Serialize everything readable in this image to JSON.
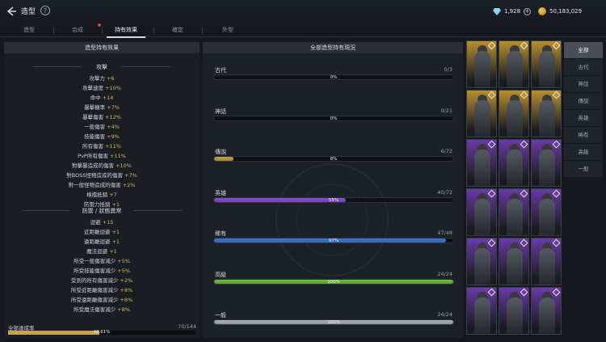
{
  "header": {
    "title": "造型",
    "gems": "1,928",
    "gold": "50,183,029"
  },
  "tabs": [
    {
      "label": "造型"
    },
    {
      "label": "合成"
    },
    {
      "label": "持有效果"
    },
    {
      "label": "確定"
    },
    {
      "label": "外型"
    }
  ],
  "left_panel": {
    "title": "造型持有效果",
    "attack_title": "攻擊",
    "attack_stats": [
      {
        "name": "攻擊力",
        "value": "+6"
      },
      {
        "name": "攻擊速度",
        "value": "+10%"
      },
      {
        "name": "命中",
        "value": "+14"
      },
      {
        "name": "暴擊機率",
        "value": "+7%"
      },
      {
        "name": "暴擊傷害",
        "value": "+12%"
      },
      {
        "name": "一般傷害",
        "value": "+4%"
      },
      {
        "name": "技能傷害",
        "value": "+9%"
      },
      {
        "name": "所有傷害",
        "value": "+11%"
      },
      {
        "name": "PvP所有傷害",
        "value": "+11%"
      },
      {
        "name": "對擊暴造成的傷害",
        "value": "+10%"
      },
      {
        "name": "對BOSS怪物造成的傷害",
        "value": "+7%"
      },
      {
        "name": "對一般怪物造成的傷害",
        "value": "+2%"
      },
      {
        "name": "格擋抵銷",
        "value": "+7"
      },
      {
        "name": "防禦力抵銷",
        "value": "+1"
      }
    ],
    "defense_title": "防禦 / 狀態異常",
    "defense_stats": [
      {
        "name": "迴避",
        "value": "+15"
      },
      {
        "name": "近距離迴避",
        "value": "+1"
      },
      {
        "name": "遠距離迴避",
        "value": "+1"
      },
      {
        "name": "魔法迴避",
        "value": "+1"
      },
      {
        "name": "所受一般傷害減少",
        "value": "+5%"
      },
      {
        "name": "所受技能傷害減少",
        "value": "+5%"
      },
      {
        "name": "受到的所有傷害減少",
        "value": "+2%"
      },
      {
        "name": "所受近距離傷害減少",
        "value": "+8%"
      },
      {
        "name": "所受遠距離傷害減少",
        "value": "+8%"
      },
      {
        "name": "所受魔法傷害減少",
        "value": "+8%"
      }
    ],
    "achievement_label": "全部達成率",
    "achievement_count": "70/144",
    "achievement_pct": "48.61%",
    "achievement_fraction": 0.4861
  },
  "mid_panel": {
    "title": "全部造型持有現況",
    "rarities": [
      {
        "name": "古代",
        "count": "0/3",
        "pct": "0%",
        "fraction": 0.0,
        "color": "#7d8a95"
      },
      {
        "name": "神話",
        "count": "0/21",
        "pct": "0%",
        "fraction": 0.0,
        "color": "#c0392b"
      },
      {
        "name": "傳說",
        "count": "6/72",
        "pct": "8%",
        "fraction": 0.08,
        "color": "#c8a03f"
      },
      {
        "name": "英雄",
        "count": "40/72",
        "pct": "55%",
        "fraction": 0.55,
        "color": "#8a4fd6"
      },
      {
        "name": "稀有",
        "count": "47/48",
        "pct": "97%",
        "fraction": 0.97,
        "color": "#3a78d6"
      },
      {
        "name": "高級",
        "count": "24/24",
        "pct": "100%",
        "fraction": 1.0,
        "color": "#6fbf3a"
      },
      {
        "name": "一般",
        "count": "24/24",
        "pct": "100%",
        "fraction": 1.0,
        "color": "#aeb3b9"
      }
    ]
  },
  "filters": [
    {
      "label": "全部"
    },
    {
      "label": "古代"
    },
    {
      "label": "神話"
    },
    {
      "label": "傳說"
    },
    {
      "label": "英雄"
    },
    {
      "label": "稀有"
    },
    {
      "label": "高級"
    },
    {
      "label": "一般"
    }
  ],
  "gallery": [
    {
      "tier": "legend",
      "color": "#b8902f"
    },
    {
      "tier": "legend",
      "color": "#b8902f"
    },
    {
      "tier": "legend",
      "color": "#b8902f"
    },
    {
      "tier": "legend",
      "color": "#b8902f"
    },
    {
      "tier": "legend",
      "color": "#b8902f"
    },
    {
      "tier": "legend",
      "color": "#b8902f"
    },
    {
      "tier": "hero",
      "color": "#6a3aa8"
    },
    {
      "tier": "hero",
      "color": "#6a3aa8"
    },
    {
      "tier": "hero",
      "color": "#6a3aa8"
    },
    {
      "tier": "hero",
      "color": "#6a3aa8"
    },
    {
      "tier": "hero",
      "color": "#6a3aa8"
    },
    {
      "tier": "hero",
      "color": "#6a3aa8"
    },
    {
      "tier": "hero",
      "color": "#6a3aa8"
    },
    {
      "tier": "hero",
      "color": "#6a3aa8"
    },
    {
      "tier": "hero",
      "color": "#6a3aa8"
    },
    {
      "tier": "hero",
      "color": "#6a3aa8"
    },
    {
      "tier": "hero",
      "color": "#6a3aa8"
    },
    {
      "tier": "hero",
      "color": "#6a3aa8"
    }
  ]
}
